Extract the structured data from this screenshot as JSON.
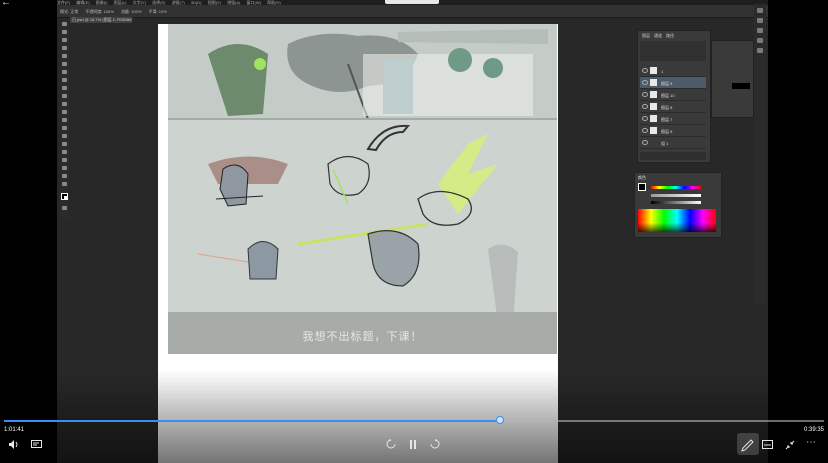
{
  "photoshop": {
    "menu": [
      "文件(F)",
      "编辑(E)",
      "图像(I)",
      "图层(L)",
      "文字(Y)",
      "选择(S)",
      "滤镜(T)",
      "3D(D)",
      "视图(V)",
      "增强(A)",
      "窗口(W)",
      "帮助(H)"
    ],
    "options": [
      "模式: 正常",
      "不透明度: 100%",
      "流量: 100%",
      "平滑: 10%"
    ],
    "doc_tab": "已.psd @ 16.7% (图层 1, RGB/8#) *",
    "canvas_caption": "我想不出标题，下课！",
    "layers_panel": {
      "tabs": [
        "图层",
        "通道",
        "路径"
      ],
      "rows": [
        "1",
        "图层 5",
        "图层 10",
        "图层 8",
        "图层 7",
        "图层 6",
        "组 1"
      ]
    },
    "color_panel": {
      "title": "颜色"
    },
    "colors": {
      "accent": "#3b8ef0",
      "panel": "#3a3a3a",
      "canvas_bg": "#cdd4d0"
    }
  },
  "player": {
    "top_button": "",
    "elapsed": "1:01:41",
    "duration": "0:39:35",
    "progress": 0.605,
    "icons": [
      "back-icon",
      "volume-icon",
      "danmaku-icon",
      "rewind-icon",
      "pause-icon",
      "forward-icon",
      "draw-icon",
      "subtitle-icon",
      "exit-fullscreen-icon",
      "more-icon"
    ]
  }
}
